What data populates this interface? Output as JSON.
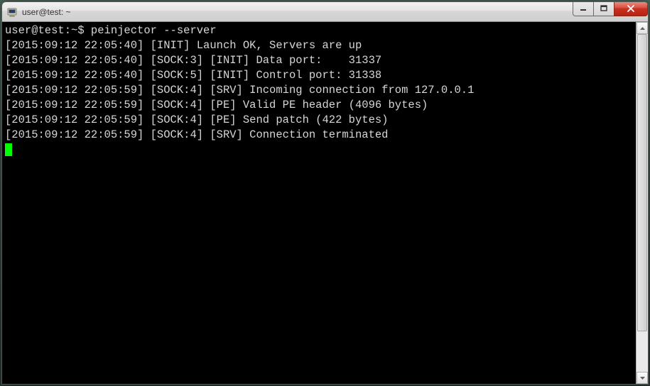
{
  "window": {
    "title": "user@test: ~"
  },
  "terminal": {
    "prompt": "user@test:~$ ",
    "command": "peinjector --server",
    "lines": [
      "[2015:09:12 22:05:40] [INIT] Launch OK, Servers are up",
      "[2015:09:12 22:05:40] [SOCK:3] [INIT] Data port:    31337",
      "[2015:09:12 22:05:40] [SOCK:5] [INIT] Control port: 31338",
      "[2015:09:12 22:05:59] [SOCK:4] [SRV] Incoming connection from 127.0.0.1",
      "[2015:09:12 22:05:59] [SOCK:4] [PE] Valid PE header (4096 bytes)",
      "[2015:09:12 22:05:59] [SOCK:4] [PE] Send patch (422 bytes)",
      "[2015:09:12 22:05:59] [SOCK:4] [SRV] Connection terminated"
    ]
  }
}
